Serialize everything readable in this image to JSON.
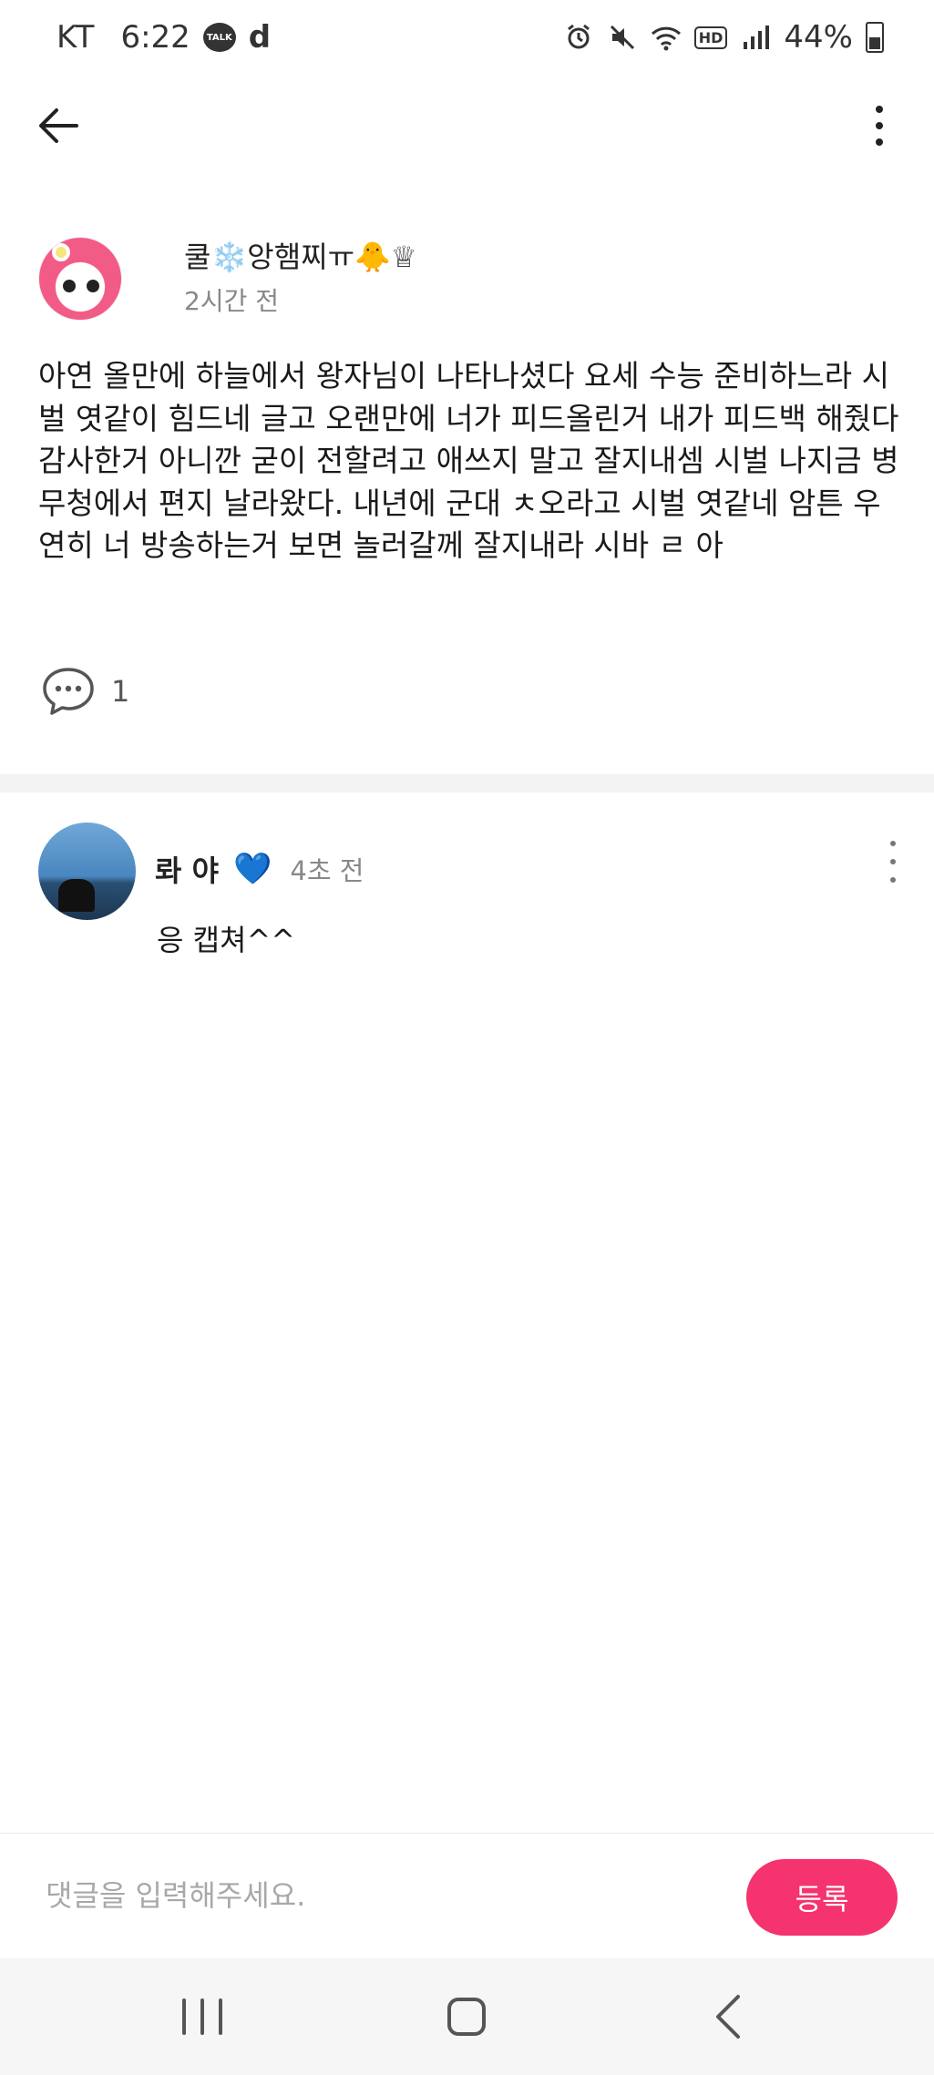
{
  "status_bar": {
    "carrier": "KT",
    "time": "6:22",
    "talk_badge": "TALK",
    "d_icon": "d",
    "hd": "HD",
    "battery": "44%"
  },
  "post": {
    "author": "쿨❄️앙햄찌ㅠ🐥♕",
    "time": "2시간 전",
    "body": "아연 올만에 하늘에서 왕자님이 나타나셨다 요세 수능 준비하느라 시벌 엿같이 힘드네 글고 오랜만에 너가 피드올린거 내가 피드백 해줬다 감사한거 아니깐 굳이 전할려고 애쓰지 말고 잘지내셈 시벌 나지금 병무청에서 편지 날라왔다. 내년에 군대 ㅊ오라고 시벌 엿같네 암튼 우연히 너 방송하는거 보면 놀러갈께 잘지내라 시바 ㄹ 아",
    "comment_count": "1"
  },
  "comment": {
    "author": "롸 야",
    "heart": "💙",
    "time": "4초 전",
    "text": "응 캡쳐^^"
  },
  "input": {
    "placeholder": "댓글을 입력해주세요.",
    "submit_label": "등록"
  },
  "colors": {
    "accent": "#f5336e",
    "heart": "#2a9df4"
  },
  "icons": {
    "back": "arrow-left-icon",
    "more": "vertical-dots-icon",
    "comment": "speech-bubble-icon",
    "nav_recent": "recent-apps-icon",
    "nav_home": "home-icon",
    "nav_back": "chevron-left-icon"
  }
}
